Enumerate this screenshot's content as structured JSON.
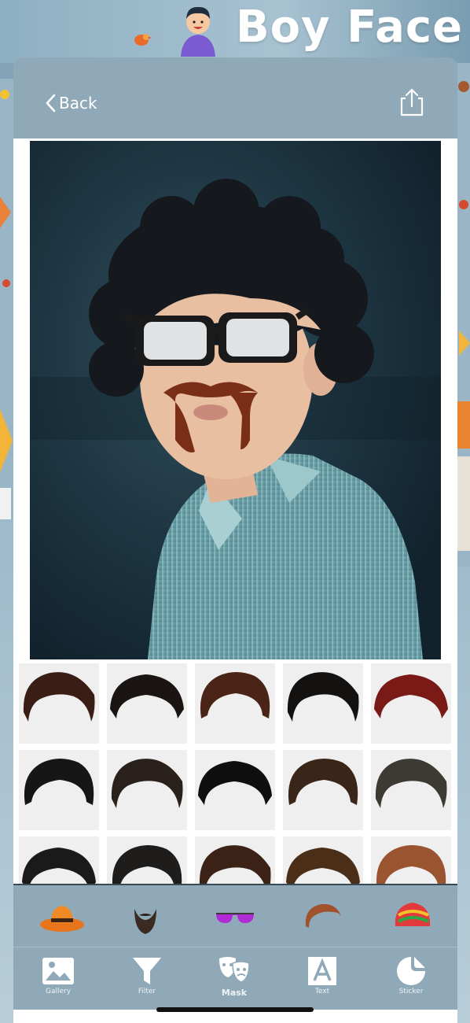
{
  "banner": {
    "title": "Boy Face",
    "avatar_icon": "boy-avatar-icon"
  },
  "header": {
    "back_label": "Back",
    "back_icon": "chevron-left-icon",
    "share_icon": "share-icon"
  },
  "photo": {
    "overlays": [
      "sunglasses",
      "mustache"
    ]
  },
  "hair_styles": [
    {
      "name": "hair-1",
      "color": "#3a1e16"
    },
    {
      "name": "hair-2",
      "color": "#1a1512"
    },
    {
      "name": "hair-3",
      "color": "#4a2417"
    },
    {
      "name": "hair-4",
      "color": "#141111"
    },
    {
      "name": "hair-5",
      "color": "#7a1a17"
    },
    {
      "name": "hair-6",
      "color": "#161616"
    },
    {
      "name": "hair-7",
      "color": "#2b211c"
    },
    {
      "name": "hair-8",
      "color": "#0f0f0f"
    },
    {
      "name": "hair-9",
      "color": "#3a2618"
    },
    {
      "name": "hair-10",
      "color": "#3d3a33"
    },
    {
      "name": "hair-11",
      "color": "#1a1a1a"
    },
    {
      "name": "hair-12",
      "color": "#1f1d1c"
    },
    {
      "name": "hair-13",
      "color": "#3b2116"
    },
    {
      "name": "hair-14",
      "color": "#4a2e18"
    },
    {
      "name": "hair-15",
      "color": "#9a5530"
    }
  ],
  "categories": [
    {
      "name": "hat",
      "icon": "hat-icon"
    },
    {
      "name": "beard",
      "icon": "beard-icon"
    },
    {
      "name": "glasses",
      "icon": "glasses-icon"
    },
    {
      "name": "hair",
      "icon": "hair-icon"
    },
    {
      "name": "turban",
      "icon": "turban-icon"
    }
  ],
  "tabs": [
    {
      "label": "Gallery",
      "icon": "gallery-icon"
    },
    {
      "label": "Filter",
      "icon": "filter-icon"
    },
    {
      "label": "Mask",
      "icon": "mask-icon",
      "active": true
    },
    {
      "label": "Text",
      "icon": "text-icon"
    },
    {
      "label": "Sticker",
      "icon": "sticker-icon"
    }
  ],
  "colors": {
    "sheet": "#90a9b8",
    "accent_white": "#ffffff"
  }
}
